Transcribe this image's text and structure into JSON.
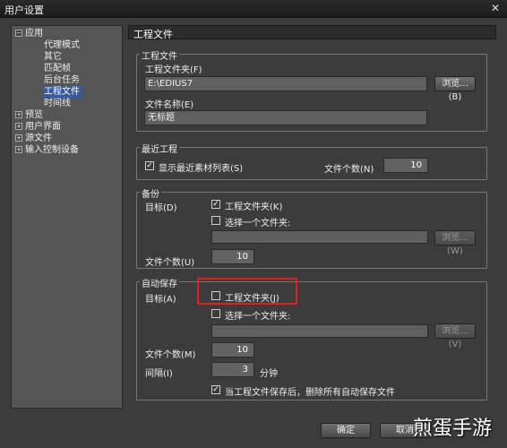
{
  "window": {
    "title": "用户设置",
    "close_glyph": "✕"
  },
  "tree": {
    "items": [
      {
        "label": "应用",
        "expander": "−"
      },
      {
        "label": "代理模式"
      },
      {
        "label": "其它"
      },
      {
        "label": "匹配帧"
      },
      {
        "label": "后台任务"
      },
      {
        "label": "工程文件"
      },
      {
        "label": "时间线"
      },
      {
        "label": "预览",
        "expander": "+"
      },
      {
        "label": "用户界面",
        "expander": "+"
      },
      {
        "label": "源文件",
        "expander": "+"
      },
      {
        "label": "输入控制设备",
        "expander": "+"
      }
    ]
  },
  "panel": {
    "header": "工程文件"
  },
  "project": {
    "group_title": "工程文件",
    "folder_label": "工程文件夹(F)",
    "folder_value": "E:\\EDIUS7",
    "browse_label": "浏览...(B)",
    "name_label": "文件名称(E)",
    "name_value": "无标题"
  },
  "recent": {
    "group_title": "最近工程",
    "show_list_label": "显示最近素材列表(S)",
    "show_list_checked": true,
    "count_label": "文件个数(N)",
    "count_value": "10"
  },
  "backup": {
    "group_title": "备份",
    "target_label": "目标(D)",
    "project_folder_label": "工程文件夹(K)",
    "project_folder_checked": true,
    "choose_folder_label": "选择一个文件夹:",
    "choose_folder_checked": false,
    "browse_label": "浏览...(W)",
    "count_label": "文件个数(U)",
    "count_value": "10"
  },
  "autosave": {
    "group_title": "自动保存",
    "target_label": "目标(A)",
    "project_folder_label": "工程文件夹(J)",
    "project_folder_checked": false,
    "choose_folder_label": "选择一个文件夹:",
    "choose_folder_checked": false,
    "browse_label": "浏览...(V)",
    "count_label": "文件个数(M)",
    "count_value": "10",
    "interval_label": "间隔(I)",
    "interval_value": "3",
    "interval_unit": "分钟",
    "delete_label": "当工程文件保存后，删除所有自动保存文件",
    "delete_checked": true
  },
  "footer": {
    "ok_label": "确定",
    "cancel_label": "取消"
  },
  "watermark": "煎蛋手游",
  "colors": {
    "highlight": "#e02020",
    "selection": "#3a5b9a"
  }
}
